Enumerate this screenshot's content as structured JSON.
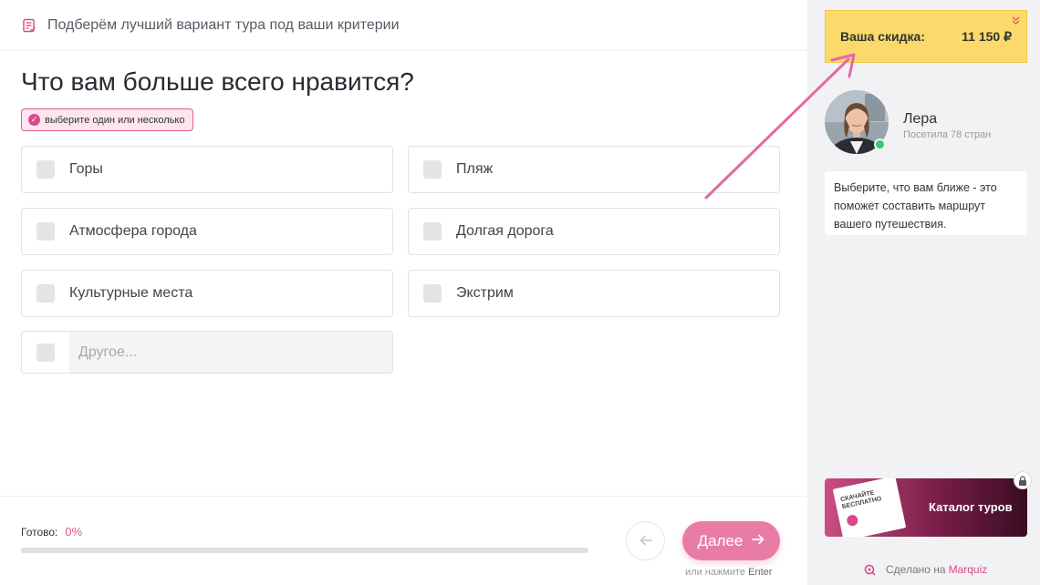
{
  "header": {
    "title": "Подберём лучший вариант тура под ваши критерии",
    "icon": "list-check-icon"
  },
  "question": {
    "title": "Что вам больше всего нравится?",
    "hint": "выберите один или несколько"
  },
  "options": [
    {
      "label": "Горы"
    },
    {
      "label": "Пляж"
    },
    {
      "label": "Атмосфера города"
    },
    {
      "label": "Долгая дорога"
    },
    {
      "label": "Культурные места"
    },
    {
      "label": "Экстрим"
    }
  ],
  "other": {
    "placeholder": "Другое..."
  },
  "footer": {
    "ready_label": "Готово:",
    "ready_percent": "0%",
    "progress": 0,
    "next_label": "Далее",
    "enter_hint_prefix": "или нажмите",
    "enter_hint_key": "Enter"
  },
  "sidebar": {
    "discount_label": "Ваша скидка:",
    "discount_value": "11 150 ₽",
    "manager_name": "Лера",
    "manager_sub": "Посетила 78 стран",
    "bubble_text": "Выберите, что вам ближе - это поможет составить маршрут вашего путешествия.",
    "catalog_label": "Каталог туров",
    "catalog_book_text": "СКАЧАЙТЕ БЕСПЛАТНО",
    "made_prefix": "Сделано на",
    "made_brand": "Marquiz"
  },
  "colors": {
    "accent": "#e0558f",
    "discount_bg": "#fbd96a",
    "online": "#2ecc71"
  }
}
